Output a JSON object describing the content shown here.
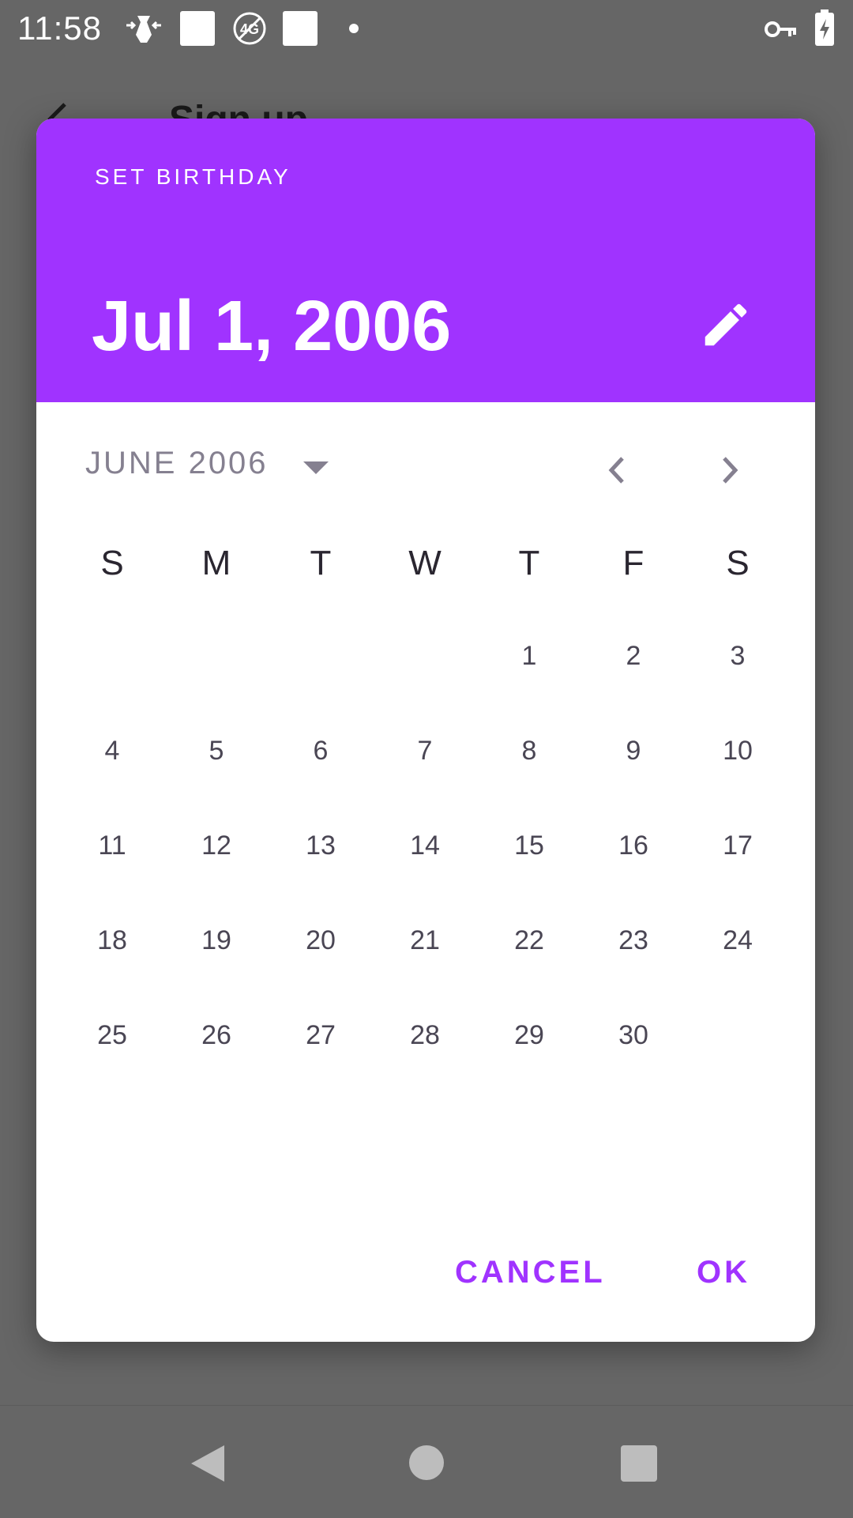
{
  "status_bar": {
    "time": "11:58",
    "icons": [
      "signal-overlay-icon",
      "square-icon",
      "no-4g-icon",
      "square-icon",
      "dot-icon",
      "vpn-key-icon",
      "battery-charging-icon"
    ]
  },
  "app_bar": {
    "title": "Sign up"
  },
  "dialog": {
    "caption": "SET BIRTHDAY",
    "selected_date": "Jul 1, 2006",
    "month_label": "JUNE 2006",
    "weekdays": [
      "S",
      "M",
      "T",
      "W",
      "T",
      "F",
      "S"
    ],
    "weeks": [
      [
        "",
        "",
        "",
        "",
        "1",
        "2",
        "3"
      ],
      [
        "4",
        "5",
        "6",
        "7",
        "8",
        "9",
        "10"
      ],
      [
        "11",
        "12",
        "13",
        "14",
        "15",
        "16",
        "17"
      ],
      [
        "18",
        "19",
        "20",
        "21",
        "22",
        "23",
        "24"
      ],
      [
        "25",
        "26",
        "27",
        "28",
        "29",
        "30",
        ""
      ]
    ],
    "cancel_label": "CANCEL",
    "ok_label": "OK"
  },
  "colors": {
    "accent": "#a033ff",
    "scrim": "#666666"
  },
  "navigation_bar": {
    "icons": [
      "back-icon",
      "home-icon",
      "recents-icon"
    ]
  }
}
